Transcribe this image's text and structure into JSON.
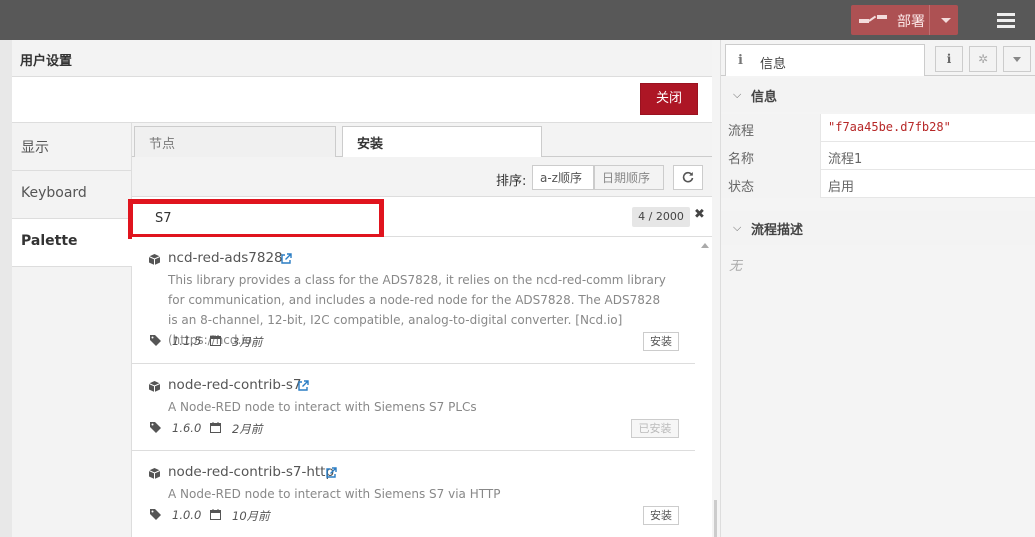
{
  "header": {
    "deploy_label": "部署"
  },
  "dialog": {
    "title": "用户设置",
    "close_label": "关闭",
    "nav": [
      {
        "label": "显示"
      },
      {
        "label": "Keyboard"
      },
      {
        "label": "Palette"
      }
    ],
    "tabs": [
      {
        "label": "节点"
      },
      {
        "label": "安装"
      }
    ],
    "sort_label": "排序:",
    "sort_options": [
      "a-z顺序",
      "日期顺序"
    ],
    "search_value": "S7",
    "result_count": "4 / 2000",
    "clear_glyph": "✖",
    "packages": [
      {
        "name": "ncd-red-ads7828",
        "description": "This library provides a class for the ADS7828, it relies on the ncd-red-comm library for communication, and includes a node-red node for the ADS7828. The ADS7828 is an 8-channel, 12-bit, I2C compatible, analog-to-digital converter. [Ncd.io](https://ncd.io",
        "version": "1.1.5",
        "updated": "3月前",
        "action": "安装",
        "installed": false
      },
      {
        "name": "node-red-contrib-s7",
        "description": "A Node-RED node to interact with Siemens S7 PLCs",
        "version": "1.6.0",
        "updated": "2月前",
        "action": "已安装",
        "installed": true
      },
      {
        "name": "node-red-contrib-s7-http",
        "description": "A Node-RED node to interact with Siemens S7 via HTTP",
        "version": "1.0.0",
        "updated": "10月前",
        "action": "安装",
        "installed": false
      }
    ]
  },
  "sidebar": {
    "tab_icon": "i",
    "tab_label": "信息",
    "btn_info": "i",
    "btn_debug": "✲",
    "section_info": "信息",
    "rows": [
      {
        "key": "流程",
        "value": "\"f7aa45be.d7fb28\""
      },
      {
        "key": "名称",
        "value": "流程1"
      },
      {
        "key": "状态",
        "value": "启用"
      }
    ],
    "section_desc": "流程描述",
    "desc_empty": "无"
  },
  "colors": {
    "header_bg": "#585858",
    "deploy_bg": "#ad5153",
    "close_bg": "#ad1625",
    "highlight": "#e0141e"
  }
}
